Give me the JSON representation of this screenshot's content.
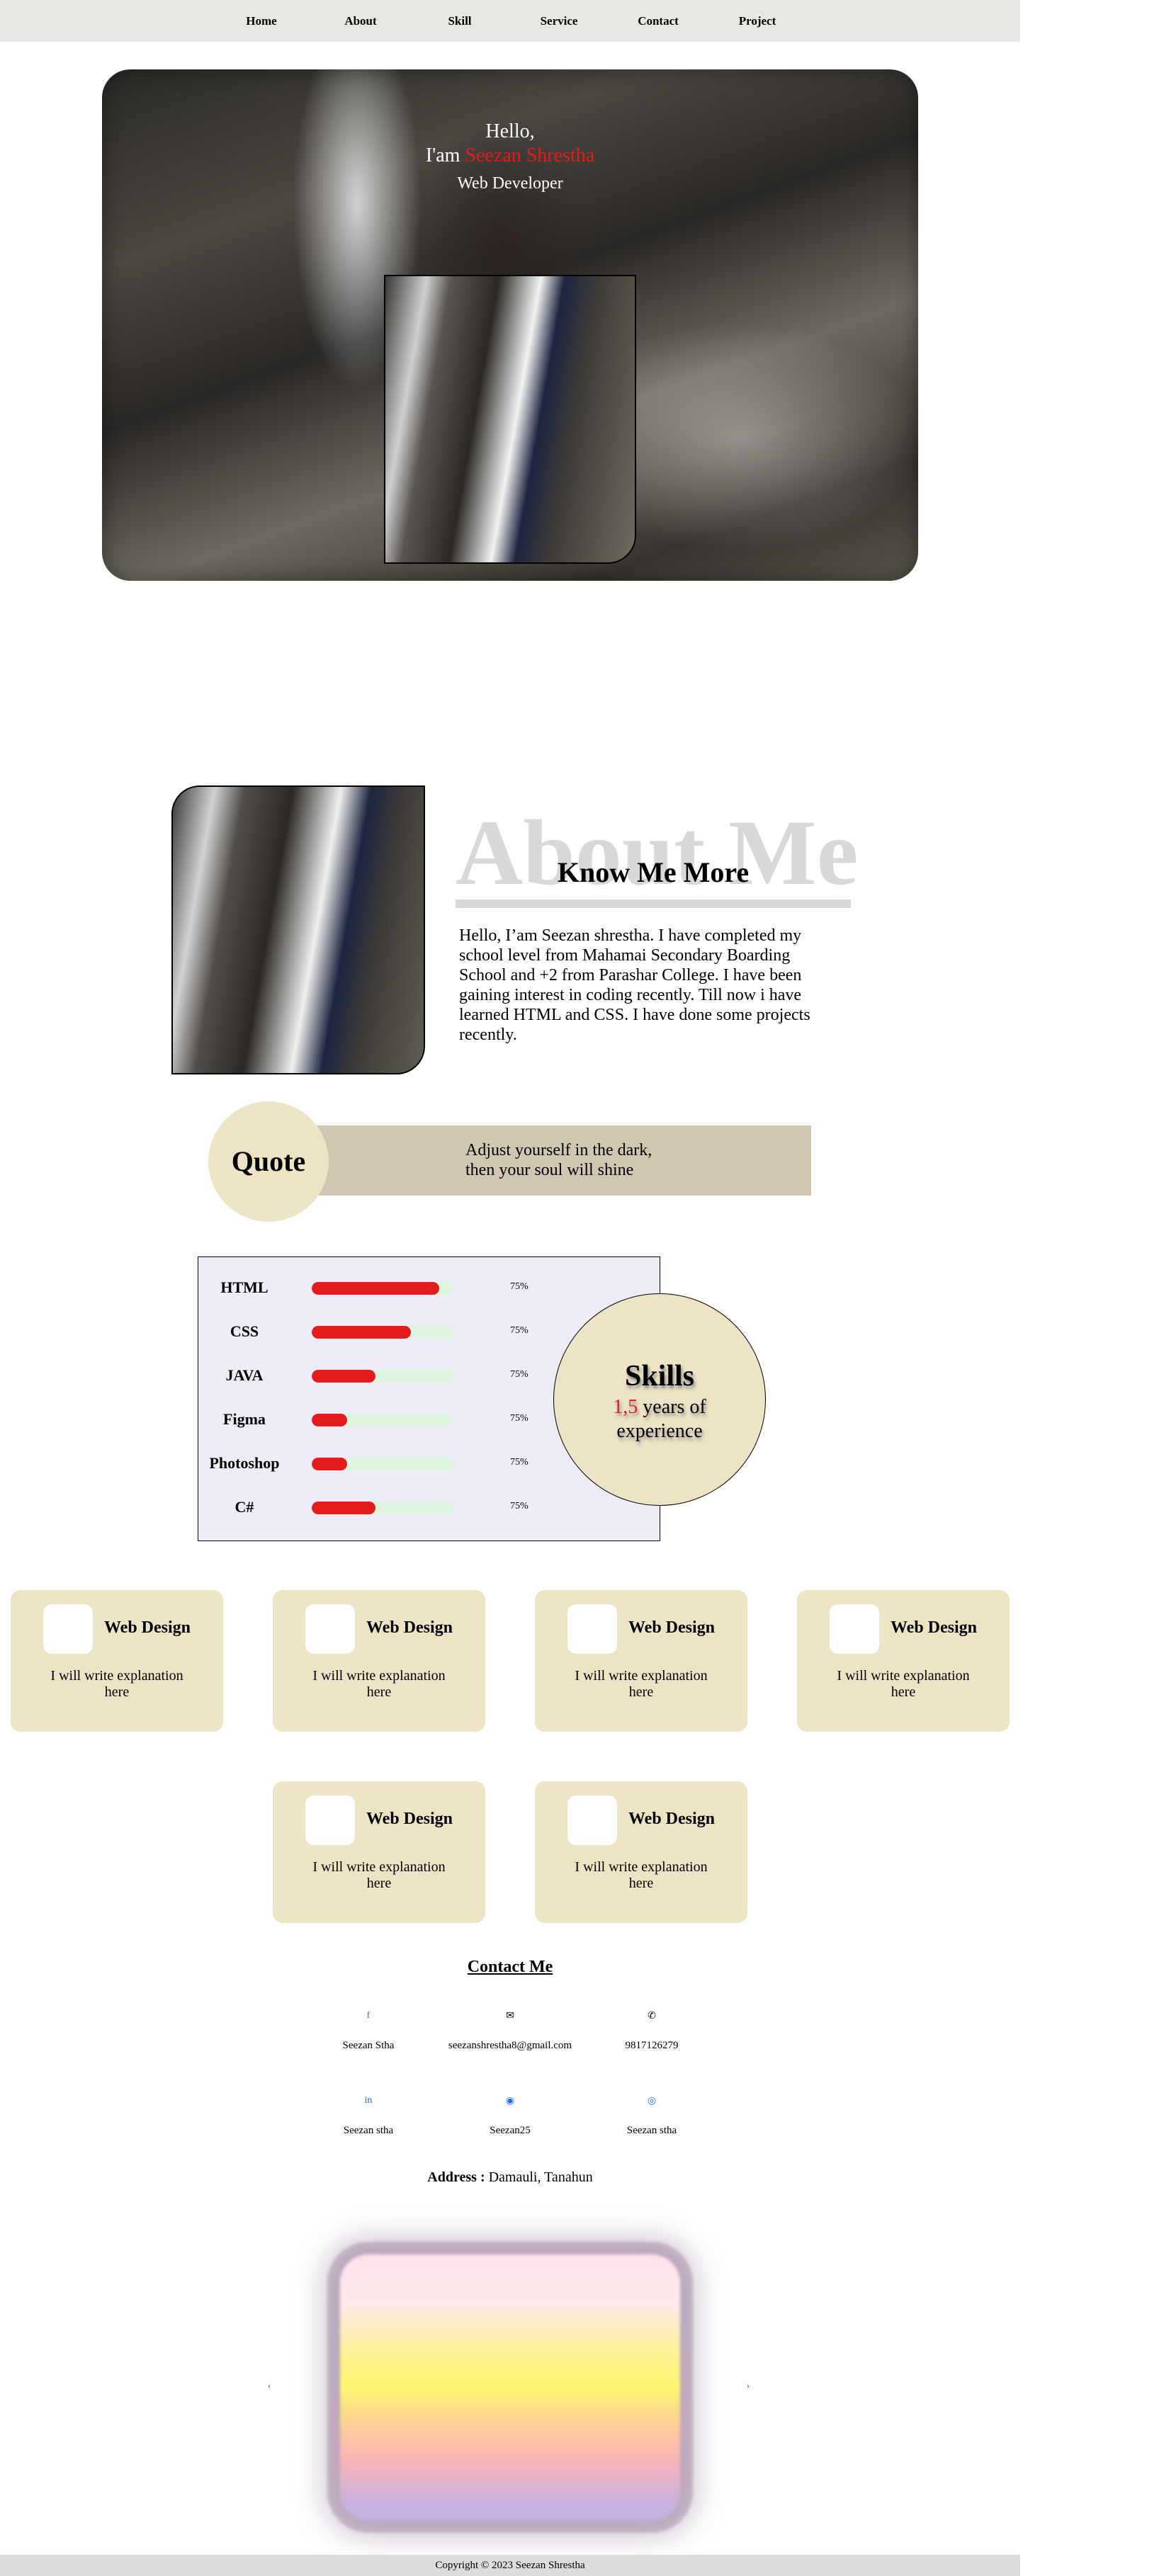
{
  "nav": {
    "items": [
      "Home",
      "About",
      "Skill",
      "Service",
      "Contact",
      "Project"
    ]
  },
  "hero": {
    "hello": "Hello,",
    "iam_prefix": "I'am ",
    "name": "Seezan Shrestha",
    "role": "Web Developer"
  },
  "about": {
    "bg_text": "About Me",
    "title": "Know Me More",
    "text": "Hello, I’am Seezan shrestha. I have completed my school level from Mahamai Secondary Boarding School and +2 from Parashar College. I have been gaining interest in coding recently. Till now i have learned HTML and CSS. I have done some projects recently."
  },
  "quote": {
    "label": "Quote",
    "line1": "Adjust yourself in the dark,",
    "line2": "then your soul will shine"
  },
  "skills": {
    "items": [
      {
        "name": "HTML",
        "pct_label": "75%",
        "fill": 0.9
      },
      {
        "name": "CSS",
        "pct_label": "75%",
        "fill": 0.7
      },
      {
        "name": "JAVA",
        "pct_label": "75%",
        "fill": 0.45
      },
      {
        "name": "Figma",
        "pct_label": "75%",
        "fill": 0.25
      },
      {
        "name": "Photoshop",
        "pct_label": "75%",
        "fill": 0.25
      },
      {
        "name": "C#",
        "pct_label": "75%",
        "fill": 0.45
      }
    ],
    "title": "Skills",
    "years": "1,5",
    "years_suffix": " years of",
    "experience": "experience",
    "fill_color": "#e31b1b",
    "track_color": "#def5df"
  },
  "services": [
    {
      "title": "Web Design",
      "desc": "I will write explanation here"
    },
    {
      "title": "Web Design",
      "desc": "I will write explanation here"
    },
    {
      "title": "Web Design",
      "desc": "I will write explanation here"
    },
    {
      "title": "Web Design",
      "desc": "I will write explanation here"
    },
    {
      "title": "Web Design",
      "desc": "I will write explanation here"
    },
    {
      "title": "Web Design",
      "desc": "I will write explanation here"
    }
  ],
  "contact": {
    "title": "Contact Me",
    "items": [
      {
        "icon": "facebook-icon",
        "glyph": "f",
        "text": "Seezan Stha"
      },
      {
        "icon": "envelope-icon",
        "glyph": "✉",
        "text": "seezanshrestha8@gmail.com"
      },
      {
        "icon": "phone-icon",
        "glyph": "✆",
        "text": "9817126279"
      },
      {
        "icon": "linkedin-icon",
        "glyph": "in",
        "text": "Seezan stha"
      },
      {
        "icon": "github-icon",
        "glyph": "◉",
        "text": "Seezan25"
      },
      {
        "icon": "instagram-icon",
        "glyph": "◎",
        "text": "Seezan stha"
      }
    ],
    "address_label": "Address :",
    "address_value": " Damauli, Tanahun"
  },
  "gallery": {
    "prev": "‹",
    "next": "›"
  },
  "footer": {
    "text": "Copyright © 2023 Seezan Shrestha"
  },
  "colors": {
    "accent": "#e31b1b",
    "beige": "#ede3c5",
    "nav_bg": "#e8e7e4"
  }
}
